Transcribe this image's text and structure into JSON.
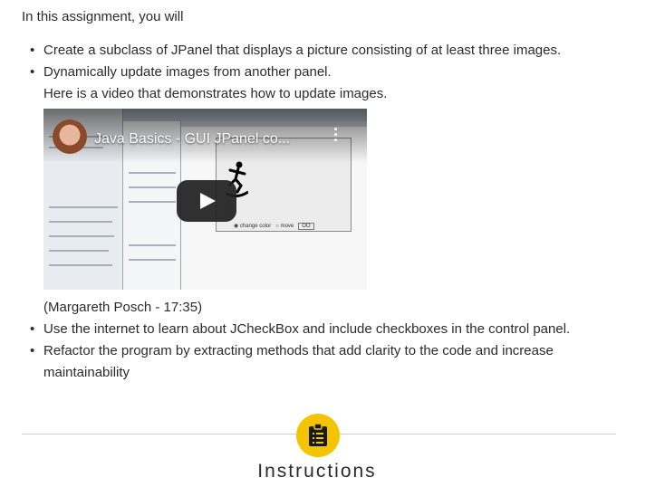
{
  "intro": "In this assignment, you will",
  "tasks": [
    "Create a subclass of JPanel that displays a picture consisting of at least three images.",
    "Dynamically update images from another panel."
  ],
  "task_sub": "Here is a video that demonstrates how to update images.",
  "video": {
    "title": "Java Basics - GUI JPanel co...",
    "credit": "(Margareth Posch - 17:35)",
    "radio_options": [
      "change color",
      "move"
    ],
    "ok_label": "OO"
  },
  "tasks_after": [
    "Use the internet to learn about JCheckBox and include checkboxes in the control panel.",
    "Refactor the program by extracting methods that add clarity to the code and increase maintainability"
  ],
  "section": {
    "title": "Instructions",
    "icon": "clipboard-icon",
    "badge_color": "#f5c400"
  }
}
